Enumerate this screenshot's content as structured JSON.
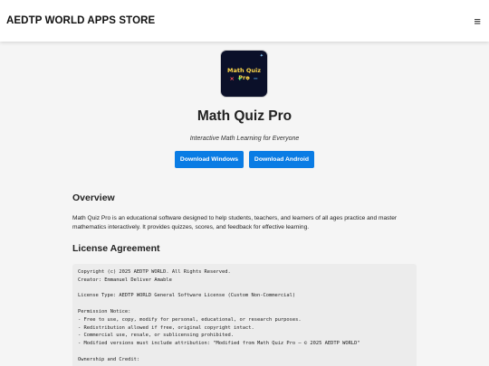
{
  "header": {
    "brand": "AEDTP WORLD APPS STORE",
    "menu_icon": "≡"
  },
  "app": {
    "icon": {
      "title": "Math Quiz Pro",
      "symbols": [
        "×",
        "+",
        "÷",
        "−"
      ],
      "sparkle": "✦"
    },
    "title": "Math Quiz Pro",
    "tagline": "Interactive Math Learning for Everyone",
    "buttons": {
      "windows": "Download Windows",
      "android": "Download Android"
    }
  },
  "overview": {
    "heading": "Overview",
    "text": "Math Quiz Pro is an educational software designed to help students, teachers, and learners of all ages practice and master mathematics interactively. It provides quizzes, scores, and feedback for effective learning."
  },
  "license": {
    "heading": "License Agreement",
    "lines": [
      "Copyright (c) 2025 AEDTP WORLD. All Rights Reserved.",
      "Creator: Emmanuel Deliver Amable",
      "",
      "License Type: AEDTP WORLD General Software License (Custom Non-Commercial)",
      "",
      "Permission Notice:",
      "- Free to use, copy, modify for personal, educational, or research purposes.",
      "- Redistribution allowed if free, original copyright intact.",
      "- Commercial use, resale, or sublicensing prohibited.",
      "- Modified versions must include attribution: \"Modified from Math Quiz Pro – © 2025 AEDTP WORLD\"",
      "",
      "Ownership and Credit:"
    ]
  },
  "colors": {
    "accent": "#0a7ce4",
    "icon_background": "#0b1029",
    "page_background": "#f5f5f5"
  }
}
